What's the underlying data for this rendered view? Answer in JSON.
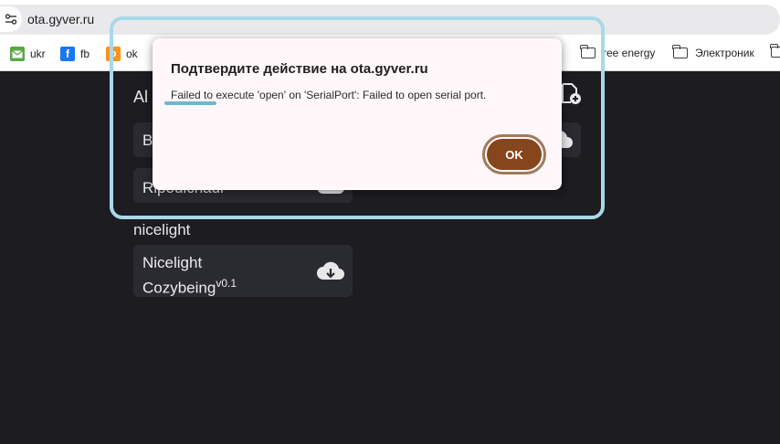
{
  "browser": {
    "url": "ota.gyver.ru"
  },
  "bookmarks": [
    {
      "label": "ukr",
      "icon": "mail-icon"
    },
    {
      "label": "fb",
      "icon": "facebook-icon"
    },
    {
      "label": "ok",
      "icon": "odnoklassniki-icon"
    },
    {
      "label": "ree energy",
      "icon": "folder-icon"
    },
    {
      "label": "Электроник",
      "icon": "folder-icon"
    }
  ],
  "page": {
    "section1_title_partial": "Al",
    "card1_partial": "B",
    "card2_partial": "Ripoulchaur",
    "section2_title": "nicelight",
    "card3": {
      "line1": "Nicelight",
      "line2": "Cozybeing",
      "version": "v0.1"
    }
  },
  "dialog": {
    "title": "Подтвердите действие на ota.gyver.ru",
    "message": "Failed to execute 'open' on 'SerialPort': Failed to open serial port.",
    "ok_label": "OK"
  },
  "colors": {
    "page_bg": "#1c1c21",
    "card_bg": "#2a2a31",
    "highlight": "#a9d8e8",
    "ok_button": "#86451b"
  }
}
